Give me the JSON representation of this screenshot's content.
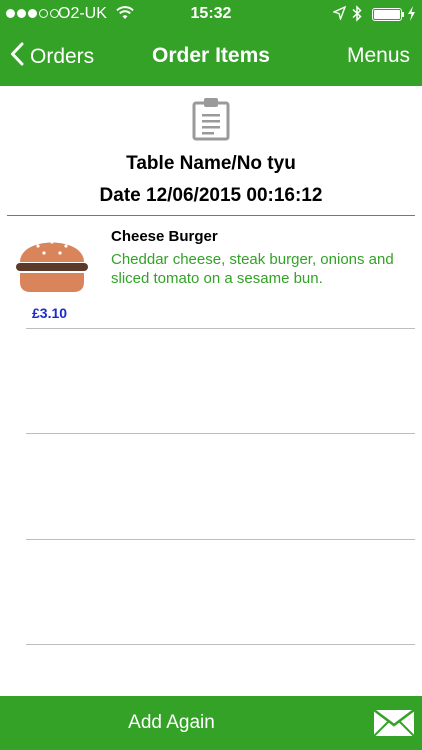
{
  "status_bar": {
    "carrier": "O2-UK",
    "time": "15:32"
  },
  "nav": {
    "back_label": "Orders",
    "title": "Order Items",
    "right_label": "Menus"
  },
  "order": {
    "table_name": "Table Name/No tyu",
    "date": "Date 12/06/2015 00:16:12"
  },
  "items": [
    {
      "name": "Cheese Burger",
      "description_line1": "Cheddar cheese, steak burger, onions and",
      "description_line2": "sliced tomato on a sesame bun.",
      "price": "£3.10",
      "icon": "burger-icon"
    }
  ],
  "bottom_bar": {
    "add_again_label": "Add Again",
    "icon": "mail-icon"
  },
  "colors": {
    "brand_green": "#33a227",
    "price_blue": "#1a2bd0"
  }
}
